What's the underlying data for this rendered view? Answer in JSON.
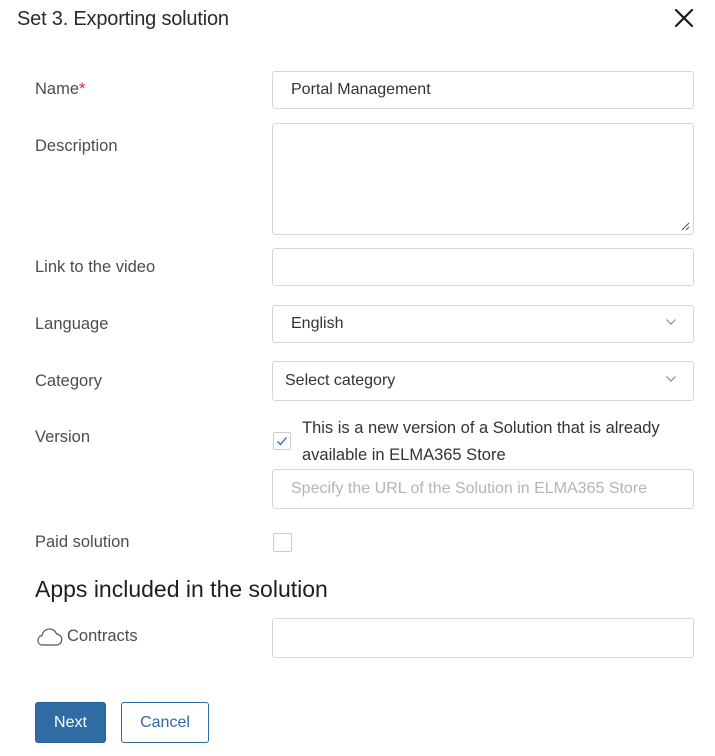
{
  "dialog": {
    "title": "Set 3. Exporting solution"
  },
  "form": {
    "name_label": "Name",
    "name_required_mark": "*",
    "name_value": "Portal Management",
    "description_label": "Description",
    "description_value": "",
    "video_label": "Link to the video",
    "video_value": "",
    "language_label": "Language",
    "language_value": "English",
    "category_label": "Category",
    "category_value": "Select category",
    "version_label": "Version",
    "version_checkbox_text": "This is a new version of a Solution that is already available in ELMA365 Store",
    "version_checked": true,
    "store_url_placeholder": "Specify the URL of the Solution in ELMA365 Store",
    "paid_label": "Paid solution",
    "paid_checked": false
  },
  "apps_section": {
    "title": "Apps included in the solution",
    "apps": [
      {
        "name": "Contracts",
        "icon": "cloud-icon",
        "value": ""
      }
    ]
  },
  "footer": {
    "next_label": "Next",
    "cancel_label": "Cancel"
  },
  "colors": {
    "primary": "#2f6ca3",
    "required": "#d8262e",
    "border": "#d6d6d6"
  }
}
